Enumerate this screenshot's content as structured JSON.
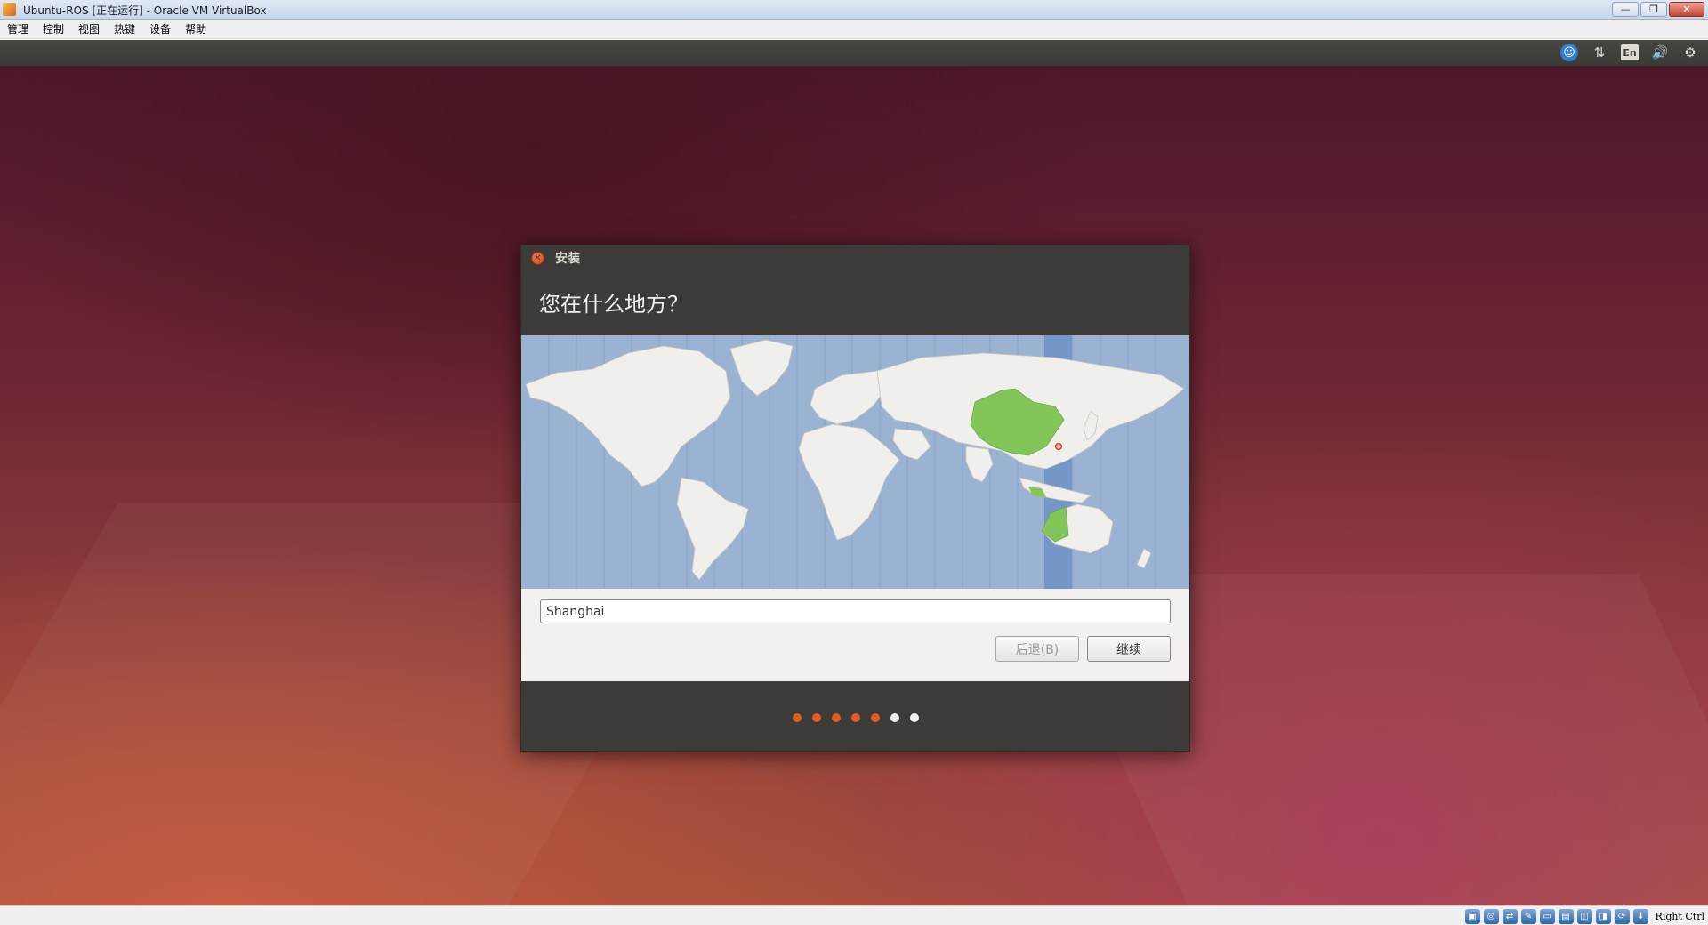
{
  "window": {
    "title": "Ubuntu-ROS [正在运行] - Oracle VM VirtualBox",
    "minimize_icon": "minimize-icon",
    "restore_icon": "restore-icon",
    "close_icon": "close-icon"
  },
  "menubar": {
    "items": [
      "管理",
      "控制",
      "视图",
      "热键",
      "设备",
      "帮助"
    ]
  },
  "ubuntu_panel": {
    "indicators": [
      {
        "name": "accessibility-icon",
        "glyph": "☺"
      },
      {
        "name": "network-arrows-icon",
        "glyph": "⇅"
      },
      {
        "name": "keyboard-language-indicator",
        "glyph": "En"
      },
      {
        "name": "volume-icon",
        "glyph": "🔊"
      },
      {
        "name": "settings-gear-icon",
        "glyph": "⚙"
      }
    ]
  },
  "installer": {
    "window_title": "安装",
    "heading": "您在什么地方？",
    "timezone_value": "Shanghai",
    "back_label": "后退(B)",
    "continue_label": "继续",
    "progress": {
      "total_steps": 7,
      "completed_steps": 5
    },
    "colors": {
      "accent_orange": "#e05d28",
      "map_ocean": "#9bb3d3",
      "map_land": "#f1efec",
      "selected_country": "#82c65a",
      "selected_timezone_band": "#7093c7",
      "dialog_dark": "#3c3b37"
    }
  },
  "statusbar": {
    "icons": [
      "hard-disk-icon",
      "optical-drive-icon",
      "usb-icon",
      "shared-folder-icon",
      "display-icon",
      "network-icon",
      "recording-icon",
      "mouse-integration-icon",
      "capture-icon",
      "keyboard-arrow-icon"
    ],
    "host_key": "Right Ctrl"
  }
}
